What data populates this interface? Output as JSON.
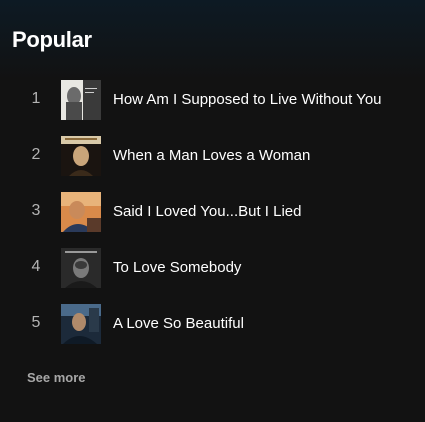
{
  "section": {
    "title": "Popular",
    "see_more_label": "See more"
  },
  "tracks": [
    {
      "rank": "1",
      "title": "How Am I Supposed to Live Without You",
      "art_icon": "album-cover-bw"
    },
    {
      "rank": "2",
      "title": "When a Man Loves a Woman",
      "art_icon": "album-cover-portrait"
    },
    {
      "rank": "3",
      "title": "Said I Loved You...But I Lied",
      "art_icon": "album-cover-warm"
    },
    {
      "rank": "4",
      "title": "To Love Somebody",
      "art_icon": "album-cover-dark"
    },
    {
      "rank": "5",
      "title": "A Love So Beautiful",
      "art_icon": "album-cover-blue"
    }
  ],
  "colors": {
    "background": "#121212",
    "header_tint": "#0d1a24",
    "text_primary": "#ffffff",
    "text_secondary": "#b3b3b3"
  }
}
